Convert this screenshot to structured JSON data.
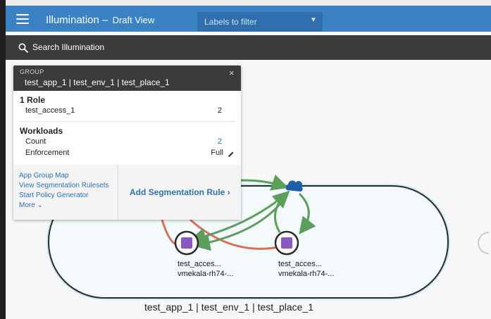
{
  "header": {
    "title": "Illumination",
    "separator": "–",
    "view_mode": "Draft View",
    "filter_placeholder": "Labels to filter",
    "menu_icon": "hamburger-icon",
    "filter_icon": "chevron-down-icon",
    "accent_color": "#3a82c4"
  },
  "search": {
    "label": "Search Illumination",
    "icon": "search-icon"
  },
  "panel": {
    "kicker": "GROUP",
    "group_name": "test_app_1 | test_env_1 | test_place_1",
    "close_glyph": "×",
    "roles_title": "1 Role",
    "roles": [
      {
        "name": "test_access_1",
        "count": "2"
      }
    ],
    "workloads_title": "Workloads",
    "workload_rows": [
      {
        "label": "Count",
        "value": "2"
      },
      {
        "label": "Enforcement",
        "value": "Full"
      }
    ],
    "footer_links": [
      "App Group Map",
      "View Segmentation Rulesets",
      "Start Policy Generator",
      "More"
    ],
    "more_glyph": "⌄",
    "add_rule_label": "Add Segmentation Rule",
    "add_rule_glyph": "›"
  },
  "graph": {
    "group_label": "test_app_1 | test_env_1 | test_place_1",
    "nodes": [
      {
        "name": "test_acces...",
        "host": "vmekala-rh74-..."
      },
      {
        "name": "test_acces...",
        "host": "vmekala-rh74-..."
      }
    ],
    "colors": {
      "allowed_flow": "#5c9e5c",
      "blocked_flow": "#d9705a",
      "node_fill": "#8a56c2",
      "group_border": "#9fd8ef",
      "cloud": "#1f5ea8"
    }
  }
}
